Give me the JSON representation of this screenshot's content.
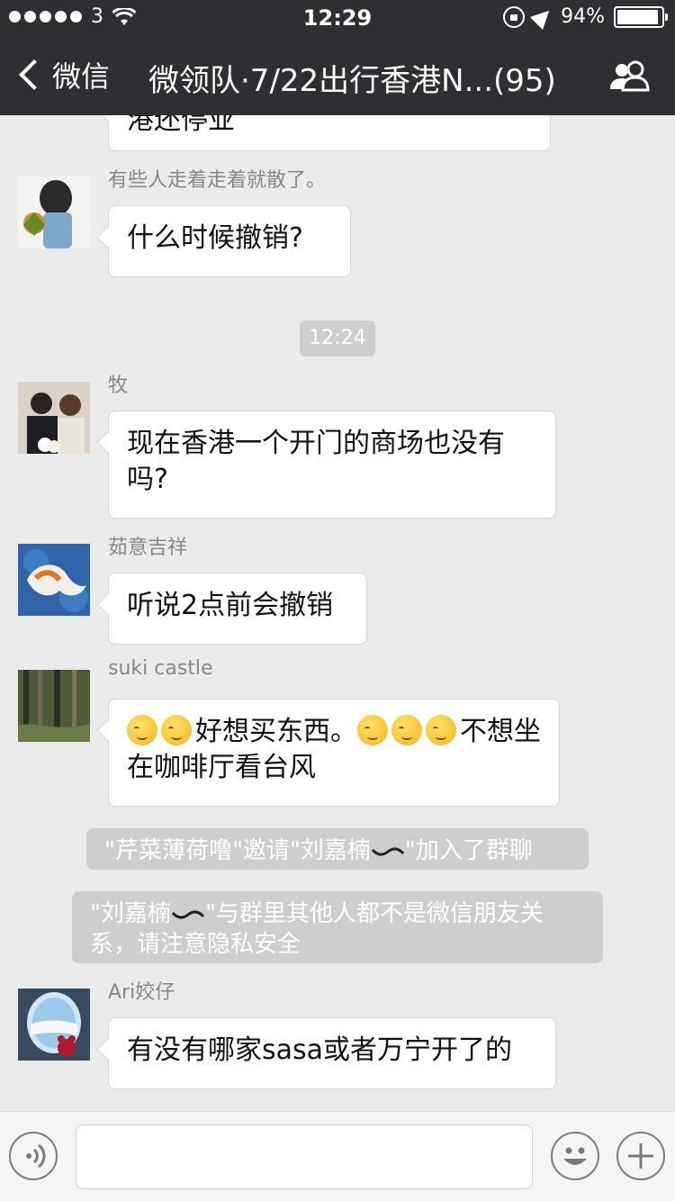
{
  "status_bar": {
    "carrier": "3",
    "time": "12:29",
    "battery": "94%",
    "battery_level": 0.94
  },
  "nav": {
    "back_label": "微信",
    "title": "微领队·7/22出行香港N...(95)"
  },
  "chat": {
    "partial_message": "港还停业",
    "timestamp": "12:24",
    "messages": [
      {
        "sender": "有些人走着走着就散了。",
        "text": "什么时候撤销?"
      },
      {
        "sender": "牧",
        "text": "现在香港一个开门的商场也没有吗?"
      },
      {
        "sender": "茹意吉祥",
        "text": "听说2点前会撤销"
      },
      {
        "sender": "suki castle",
        "text_a": "好想买东西。",
        "text_b": "不想坐在咖啡厅看台风"
      },
      {
        "sender": "Ari姣仔",
        "text": "有没有哪家sasa或者万宁开了的"
      }
    ],
    "system_1": {
      "pre": "\"芹菜薄荷噜\"邀请\"刘嘉楠",
      "post": "\"加入了群聊"
    },
    "system_2": {
      "pre": "\"刘嘉楠",
      "post": "\"与群里其他人都不是微信朋友关系，请注意隐私安全"
    }
  },
  "colors": {
    "topbar": "#2f2e33",
    "chat_bg": "#ebebeb",
    "system_chip": "#cecece"
  },
  "icons": {
    "voice": "voice-icon",
    "emoji": "emoji-icon",
    "plus": "plus-icon",
    "group": "group-icon",
    "back": "back-chevron-icon"
  }
}
